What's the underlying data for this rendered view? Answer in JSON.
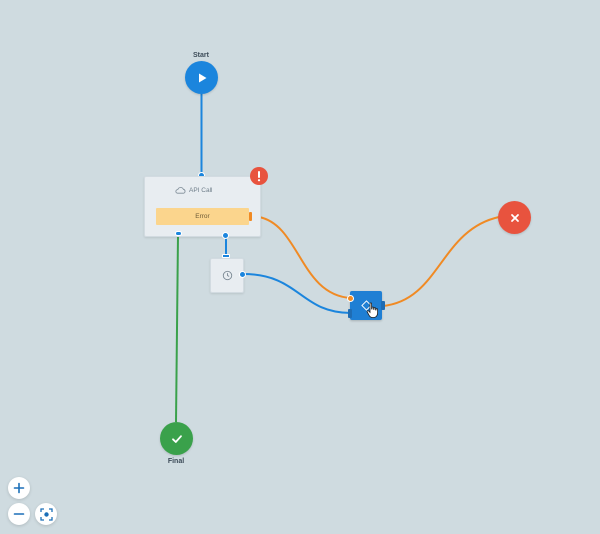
{
  "nodes": {
    "start": {
      "label": "Start",
      "icon": "play-icon"
    },
    "api_call": {
      "title": "API Call",
      "icon": "cloud-icon",
      "error_label": "Error",
      "status_icon": "alert-icon"
    },
    "timer": {
      "icon": "clock-icon"
    },
    "merge": {
      "icon": "diamond-icon"
    },
    "error_end": {
      "icon": "close-icon"
    },
    "final": {
      "label": "Final",
      "icon": "check-icon"
    }
  },
  "controls": {
    "zoom_in": {
      "icon": "plus-icon"
    },
    "zoom_out": {
      "icon": "minus-icon"
    },
    "fit_view": {
      "icon": "fit-view-icon"
    }
  },
  "colors": {
    "canvas_bg": "#cfdbe0",
    "primary_wire": "#1b85dd",
    "error_wire": "#f08a24",
    "success_wire": "#3aa14b",
    "start": "#1b85dd",
    "final": "#3aa14b",
    "error_end": "#e8533e",
    "error_bar": "#fbd58d"
  }
}
